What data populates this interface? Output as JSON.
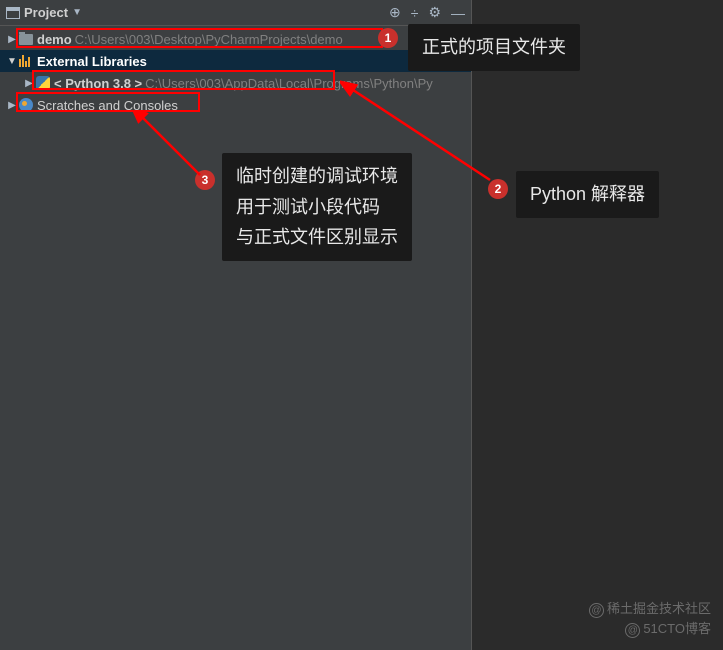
{
  "header": {
    "title": "Project",
    "dropdown": "▼"
  },
  "tree": {
    "demo": {
      "name": "demo",
      "path": "C:\\Users\\003\\Desktop\\PyCharmProjects\\demo"
    },
    "external_libraries": {
      "name": "External Libraries"
    },
    "python": {
      "name": "< Python 3.8 >",
      "path": "C:\\Users\\003\\AppData\\Local\\Programs\\Python\\Py"
    },
    "scratches": {
      "name": "Scratches and Consoles"
    }
  },
  "annotations": {
    "badge1": "1",
    "badge2": "2",
    "badge3": "3",
    "box1": "正式的项目文件夹",
    "box2": "Python 解释器",
    "box3_line1": "临时创建的调试环境",
    "box3_line2": "用于测试小段代码",
    "box3_line3": "与正式文件区别显示"
  },
  "watermarks": {
    "wm1": "稀土掘金技术社区",
    "wm2": "51CTO博客"
  }
}
